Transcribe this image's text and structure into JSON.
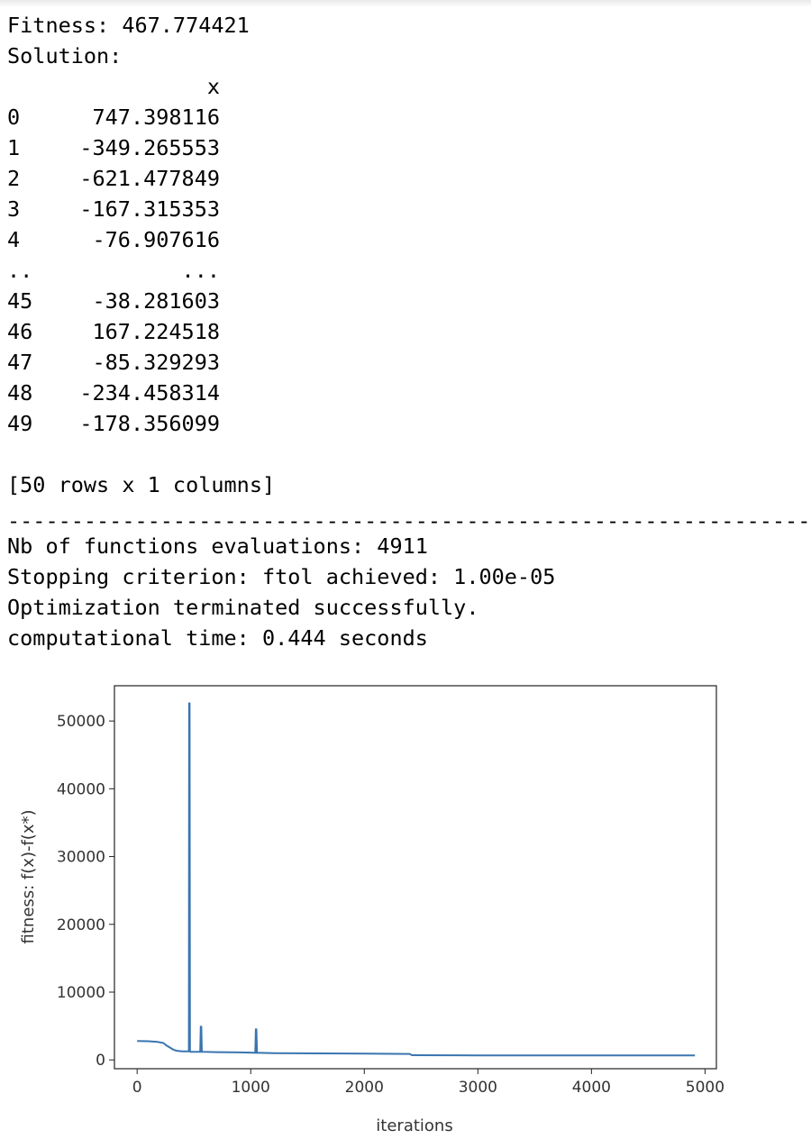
{
  "output": {
    "fitness_line": "Fitness: 467.774421",
    "solution_label": "Solution:",
    "column_header": "x",
    "rows": [
      {
        "index": "0",
        "value": "747.398116"
      },
      {
        "index": "1",
        "value": "-349.265553"
      },
      {
        "index": "2",
        "value": "-621.477849"
      },
      {
        "index": "3",
        "value": "-167.315353"
      },
      {
        "index": "4",
        "value": "-76.907616"
      },
      {
        "index": "..",
        "value": "..."
      },
      {
        "index": "45",
        "value": "-38.281603"
      },
      {
        "index": "46",
        "value": "167.224518"
      },
      {
        "index": "47",
        "value": "-85.329293"
      },
      {
        "index": "48",
        "value": "-234.458314"
      },
      {
        "index": "49",
        "value": "-178.356099"
      }
    ],
    "shape_line": "[50 rows x 1 columns]",
    "separator": "------------------------------------------------------------------------------",
    "nb_evals_line": "Nb of functions evaluations: 4911",
    "stopping_line": "Stopping criterion: ftol achieved: 1.00e-05",
    "terminated_line": "Optimization terminated successfully.",
    "time_line": "computational time: 0.444 seconds"
  },
  "chart_data": {
    "type": "line",
    "title": "",
    "xlabel": "iterations",
    "ylabel": "fitness: f(x)-f(x*)",
    "xlim": [
      -200,
      5100
    ],
    "ylim": [
      -1300,
      55200
    ],
    "xticks": [
      0,
      1000,
      2000,
      3000,
      4000,
      5000
    ],
    "yticks": [
      0,
      10000,
      20000,
      30000,
      40000,
      50000
    ],
    "grid": false,
    "line_color": "#3a75b0",
    "series": [
      {
        "x": [
          0,
          100,
          180,
          230,
          260,
          300,
          320,
          350,
          400,
          455,
          458,
          462,
          465,
          470,
          555,
          560,
          565,
          570,
          700,
          900,
          1040,
          1045,
          1050,
          1055,
          1200,
          1600,
          2000,
          2400,
          2420,
          2440,
          3000,
          4000,
          4911
        ],
        "y": [
          2800,
          2750,
          2650,
          2500,
          2100,
          1700,
          1500,
          1350,
          1250,
          1250,
          52600,
          52600,
          1250,
          1200,
          1200,
          4900,
          4900,
          1200,
          1150,
          1100,
          1050,
          4500,
          4500,
          1050,
          1000,
          960,
          920,
          880,
          700,
          690,
          670,
          660,
          650
        ]
      }
    ]
  }
}
